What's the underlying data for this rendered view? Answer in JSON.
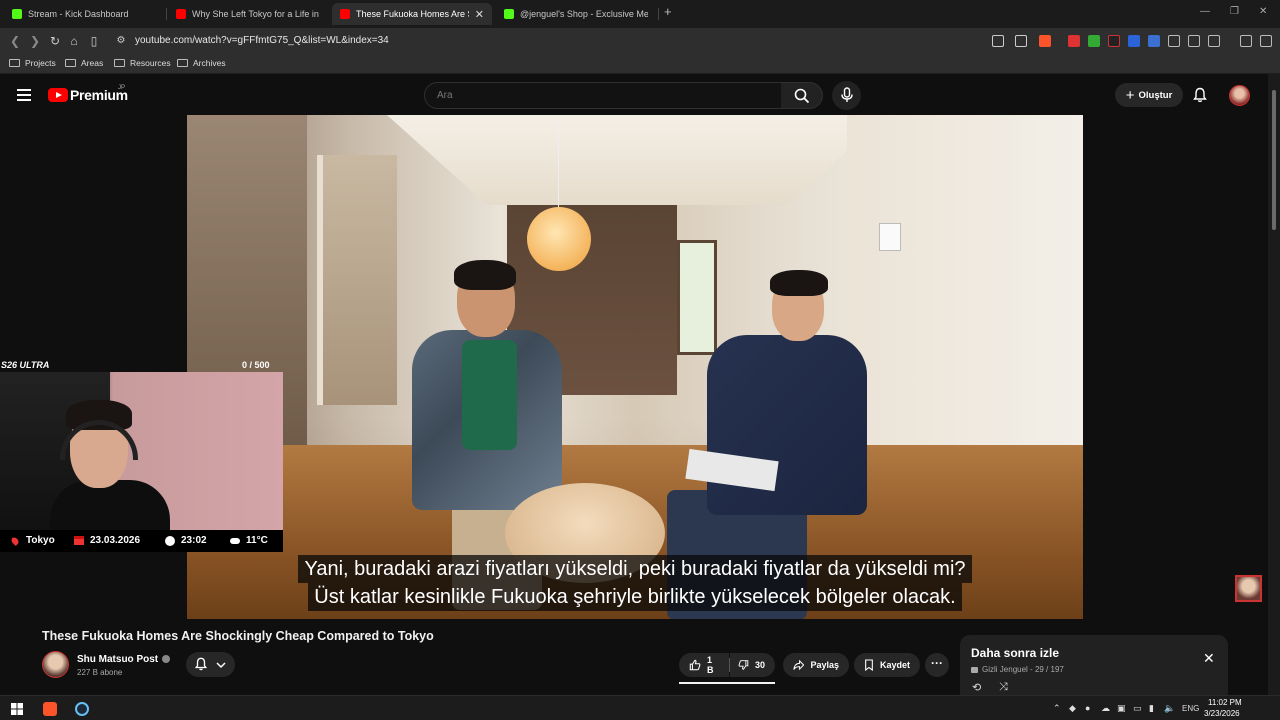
{
  "browser": {
    "tabs": [
      {
        "title": "Stream - Kick Dashboard",
        "favicon_color": "#53fc18",
        "active": false
      },
      {
        "title": "Why She Left Tokyo for a Life in Rura",
        "favicon_color": "#ff0000",
        "active": false
      },
      {
        "title": "These Fukuoka Homes Are Shocki",
        "favicon_color": "#ff0000",
        "active": true
      },
      {
        "title": "@jenguel's Shop - Exclusive Merch &",
        "favicon_color": "#53fc18",
        "active": false
      }
    ],
    "new_tab_label": "+",
    "url": "youtube.com/watch?v=gFFfmtG75_Q&list=WL&index=34",
    "bookmarks": [
      "Projects",
      "Areas",
      "Resources",
      "Archives"
    ]
  },
  "youtube": {
    "brand": "Premium",
    "region_badge": "JP",
    "search_placeholder": "Ara",
    "create_label": "Oluştur",
    "video": {
      "subtitle_line1": "Yani, buradaki arazi fiyatları yükseldi, peki buradaki fiyatlar da yükseldi mi?",
      "subtitle_line2": "Üst katlar kesinlikle Fukuoka şehriyle birlikte yükselecek bölgeler olacak."
    },
    "title": "These Fukuoka Homes Are Shockingly Cheap Compared to Tokyo",
    "channel": {
      "name": "Shu Matsuo Post",
      "subscribers": "227 B abone"
    },
    "actions": {
      "likes": "1 B",
      "dislikes": "30",
      "share": "Paylaş",
      "save": "Kaydet"
    },
    "watch_later": {
      "title": "Daha sonra izle",
      "privacy": "Gizli",
      "owner": "Jenguel",
      "position": "29 / 197"
    }
  },
  "stream_overlay": {
    "brand": "S26 ULTRA",
    "counter": "0  / 500",
    "location": "Tokyo",
    "date": "23.03.2026",
    "time": "23:02",
    "temperature": "11°C"
  },
  "taskbar": {
    "language": "ENG",
    "time": "11:02 PM",
    "date": "3/23/2026"
  },
  "colors": {
    "accent_red": "#ff0000",
    "kick_green": "#53fc18",
    "background": "#0f0f0f"
  }
}
